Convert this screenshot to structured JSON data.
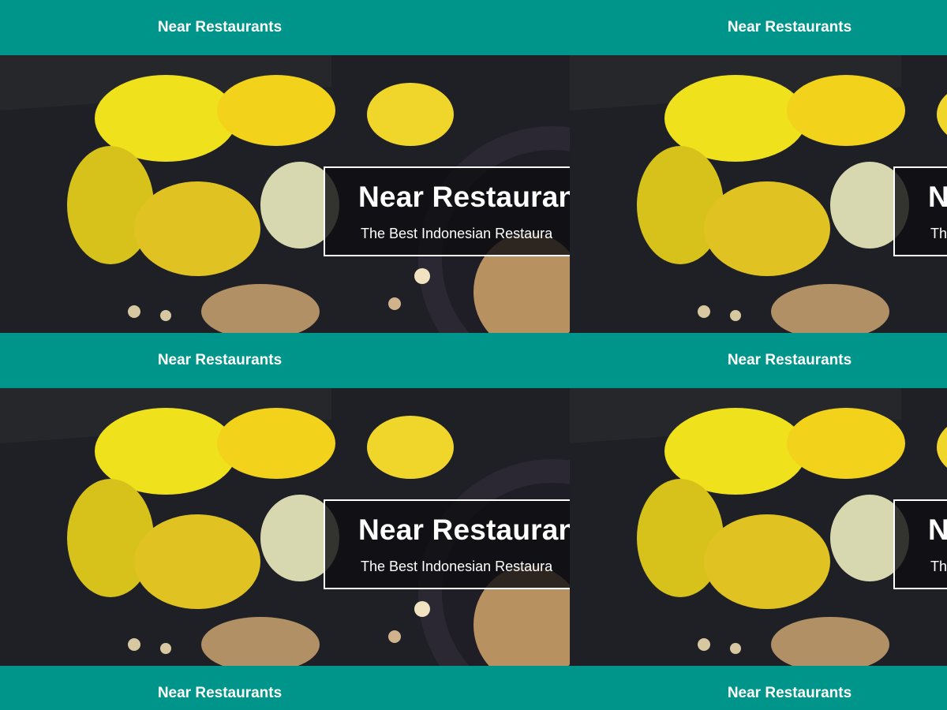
{
  "app": {
    "appbar_title": "Near Restaurants",
    "hero_title": "Near Restaurants",
    "hero_subtitle": "The Best Indonesian Restaura"
  },
  "colors": {
    "appbar": "#00958a",
    "hero_background": "#24252b",
    "card_border": "#ffffff",
    "flower_yellow": "#f2d21b"
  },
  "icons": {
    "hero_image": "daffodils-cookies-photo"
  }
}
